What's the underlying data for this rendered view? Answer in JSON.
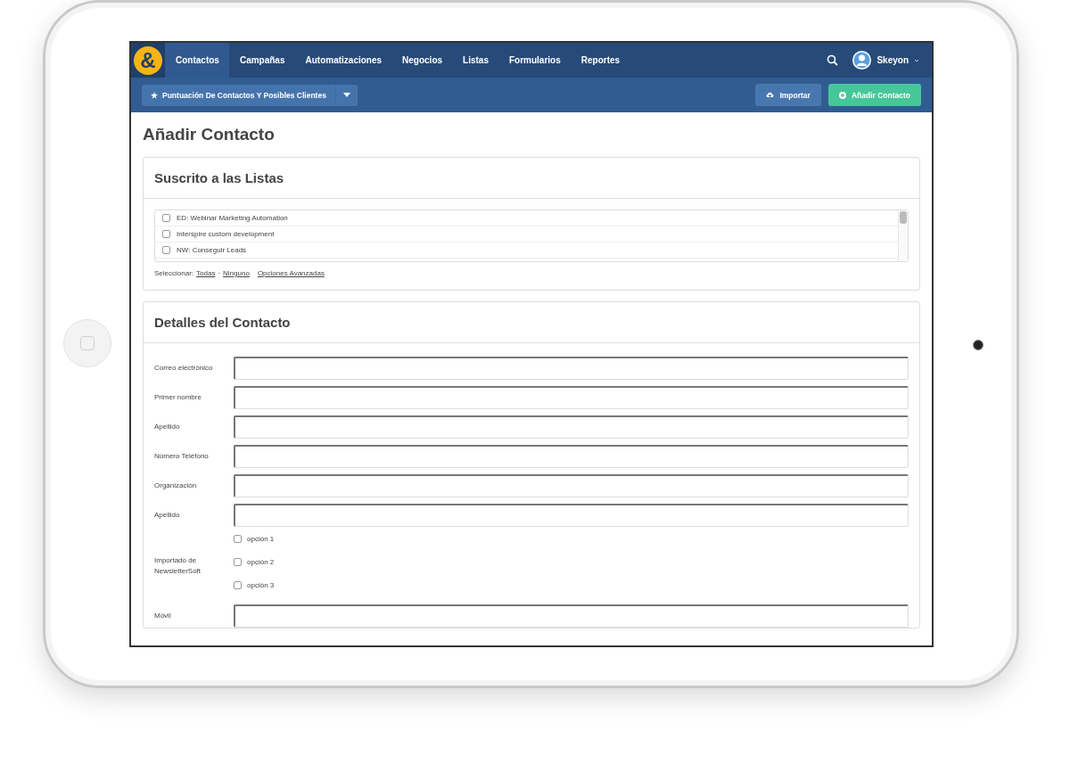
{
  "nav": {
    "logo": "&",
    "tabs": [
      {
        "label": "Contactos",
        "selected": true
      },
      {
        "label": "Campañas",
        "selected": false
      },
      {
        "label": "Automatizaciones",
        "selected": false
      },
      {
        "label": "Negocios",
        "selected": false
      },
      {
        "label": "Listas",
        "selected": false
      },
      {
        "label": "Formularios",
        "selected": false
      },
      {
        "label": "Reportes",
        "selected": false
      }
    ],
    "user": {
      "name": "Skeyon"
    }
  },
  "toolbar": {
    "dropdown": {
      "label": "Puntuación De Contactos Y Posibles Clientes"
    },
    "buttons": [
      {
        "label": "Importar",
        "kind": "secondary"
      },
      {
        "label": "Añadir Contacto",
        "kind": "primary"
      }
    ]
  },
  "page_title": "Añadir Contacto",
  "lists_card": {
    "title": "Suscrito a las Listas",
    "items": [
      {
        "label": "ED: Webinar Marketing Automation",
        "checked": false
      },
      {
        "label": "Interspire custom development",
        "checked": false
      },
      {
        "label": "NW: Conseguir Leads",
        "checked": false
      }
    ],
    "select_label": "Seleccionar:",
    "select_links": [
      {
        "label": "Todas"
      },
      {
        "label": "Ninguno"
      }
    ],
    "separator": "·",
    "advanced_link": "Opciones Avanzadas"
  },
  "details_card": {
    "title": "Detalles del Contacto",
    "fields": [
      {
        "kind": "text",
        "label": "Correo electrónico"
      },
      {
        "kind": "text",
        "label": "Primer nombre"
      },
      {
        "kind": "text",
        "label": "Apellido"
      },
      {
        "kind": "text",
        "label": "Número Teléfono"
      },
      {
        "kind": "text",
        "label": "Organización"
      },
      {
        "kind": "text",
        "label": "Apellido"
      },
      {
        "kind": "checkboxes",
        "label": "Importado de NewsletterSoft",
        "options": [
          {
            "label": "opción 1",
            "checked": false
          },
          {
            "label": "opción 2",
            "checked": false
          },
          {
            "label": "opción 3",
            "checked": false
          }
        ]
      },
      {
        "kind": "text",
        "label": "Móvil"
      }
    ]
  }
}
